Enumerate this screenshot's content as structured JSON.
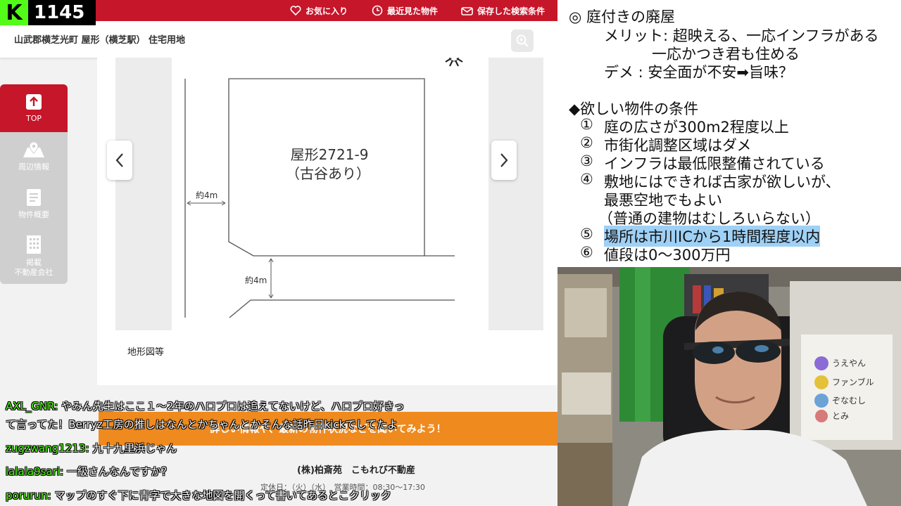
{
  "stream": {
    "logo_letter": "K",
    "viewer_count": "1145"
  },
  "topnav": {
    "favorites": "お気に入り",
    "recent": "最近見た物件",
    "saved_search": "保存した検索条件"
  },
  "breadcrumb": "山武郡横芝光町 屋形（横芝駅） 住宅用地",
  "sidebar": [
    {
      "label": "TOP",
      "icon": "arrow-up-icon"
    },
    {
      "label": "周辺情報",
      "icon": "map-pin-icon"
    },
    {
      "label": "物件概要",
      "icon": "document-icon"
    },
    {
      "label_line1": "掲載",
      "label_line2": "不動産会社",
      "icon": "building-icon"
    }
  ],
  "map": {
    "lot_name": "屋形2721-9",
    "lot_note": "（古谷あり）",
    "road_left": "約4m",
    "road_bottom": "約4m",
    "caption": "地形図等"
  },
  "banner": "詳しい情報や、最新の物件状況などを聞いてみよう！",
  "company": {
    "name": "(株)柏斎苑　こもれび不動産",
    "hours": "定休日：（火）（水）　営業時間：08:30〜17:30"
  },
  "chat": [
    {
      "user": "AXL_GNR:",
      "text": " やみん先生はここ１〜2年のハロプロは追えてないけど、ハロプロ好きっ"
    },
    {
      "user": "",
      "text": "て言ってた！Berryz工房の推しはなんとかちゃんとかそんな話昨日kickでしてたよ"
    },
    {
      "user": "zugzwang1213:",
      "text": " 九十九里浜じゃん"
    },
    {
      "user": "lalala9sari:",
      "text": " 一級さんなんですか？"
    },
    {
      "user": "porurun:",
      "text": " マップのすぐ下に青字で大きな地図を開くって書いてあるとこクリック"
    }
  ],
  "notes": {
    "l1": "◎ 庭付きの廃屋",
    "l2": "メリット: 超映える、一応インフラがある",
    "l3": "一応かつき君も住める",
    "l4": "デメ : 安全面が不安➡旨味？",
    "l5": "◆欲しい物件の条件",
    "items": [
      {
        "num": "①",
        "text": "庭の広さが300m2程度以上"
      },
      {
        "num": "②",
        "text": "市街化調整区域はダメ"
      },
      {
        "num": "③",
        "text": "インフラは最低限整備されている"
      },
      {
        "num": "④",
        "text": "敷地にはできれば古家が欲しいが、"
      },
      {
        "num": "",
        "text": "最悪空地でもよい"
      },
      {
        "num": "",
        "text": "（普通の建物はむしろいらない）"
      },
      {
        "num": "⑤",
        "text": "場所は市川ICから1時間程度以内"
      },
      {
        "num": "⑥",
        "text": "値段は0〜300万円"
      }
    ]
  },
  "webcam_labels": [
    "うえやん",
    "ファンブル",
    "ぞなむし",
    "とみ"
  ],
  "colors": {
    "brand_red": "#c6162a",
    "kick_green": "#53fc18",
    "banner_orange": "#ef8a1f",
    "highlight": "#9fd0f5"
  }
}
